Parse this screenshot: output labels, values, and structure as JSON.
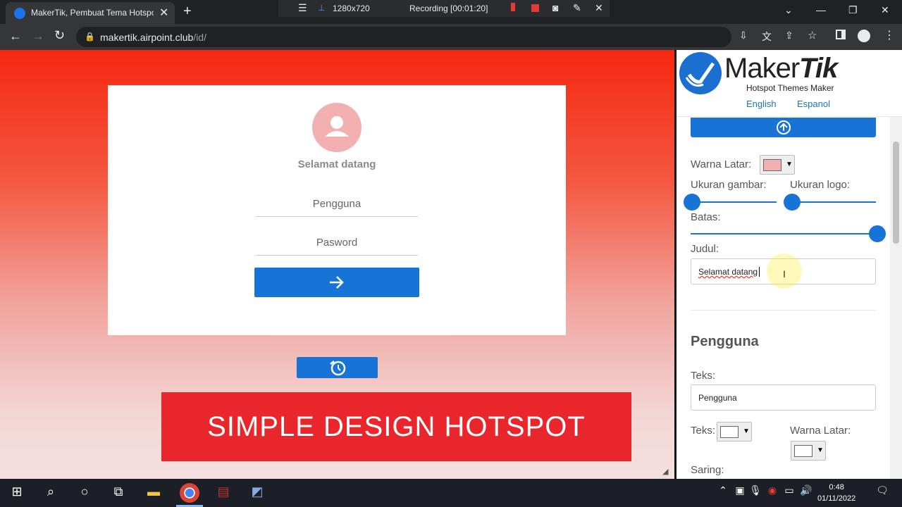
{
  "browser": {
    "tab_title": "MakerTik, Pembuat Tema Hotspot",
    "tab_close": "✕",
    "new_tab": "+",
    "url_host": "makertik.airpoint.club",
    "url_path": "/id/"
  },
  "recorder": {
    "resolution": "1280x720",
    "status": "Recording [00:01:20]"
  },
  "preview": {
    "welcome": "Selamat datang",
    "username_placeholder": "Pengguna",
    "password_placeholder": "Pasword",
    "banner": "SIMPLE DESIGN HOTSPOT"
  },
  "panel": {
    "logo_main": "MakerTik",
    "logo_sub": "Hotspot Themes Maker",
    "lang_english": "English",
    "lang_espanol": "Espanol",
    "bg_color_label": "Warna Latar:",
    "image_size_label": "Ukuran gambar:",
    "logo_size_label": "Ukuran logo:",
    "border_label": "Batas:",
    "title_label": "Judul:",
    "title_value": "Selamat datang",
    "section_user": "Pengguna",
    "text_label": "Teks:",
    "text_value": "Pengguna",
    "text_color_label": "Teks:",
    "bg_color2_label": "Warna Latar:",
    "filter_label": "Saring:",
    "image_size_level": 0,
    "logo_size_level": 0,
    "border_level": 1
  },
  "colors": {
    "accent": "#1873d6",
    "bg_swatch": "#f2b1b0",
    "text_swatch": "#ffffff",
    "bg2_swatch": "#ffffff"
  },
  "taskbar": {
    "time": "0:48",
    "date": "01/11/2022"
  }
}
